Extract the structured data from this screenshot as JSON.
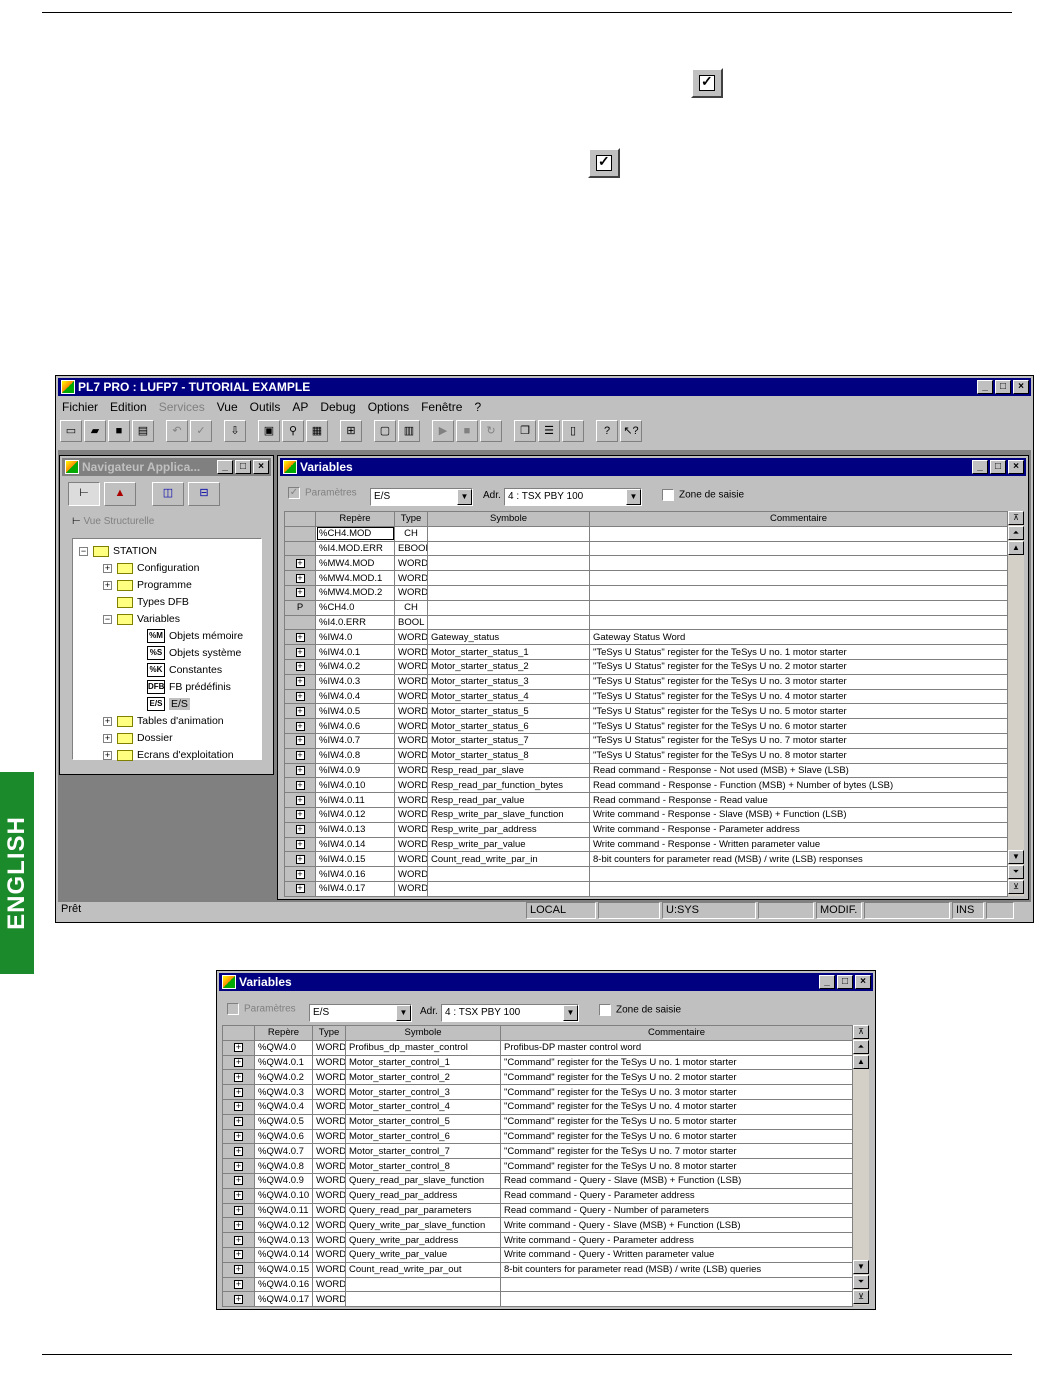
{
  "side_tab": "ENGLISH",
  "main_window": {
    "title": "PL7 PRO : LUFP7 - TUTORIAL EXAMPLE",
    "menu": [
      "Fichier",
      "Edition",
      "Services",
      "Vue",
      "Outils",
      "AP",
      "Debug",
      "Options",
      "Fenêtre",
      "?"
    ],
    "status": {
      "ready": "Prêt",
      "local": "LOCAL",
      "usys": "U:SYS",
      "modif": "MODIF.",
      "ins": "INS"
    },
    "navigator": {
      "title": "Navigateur Applica...",
      "view_label": "Vue Structurelle",
      "items": [
        "STATION",
        "Configuration",
        "Programme",
        "Types DFB",
        "Variables",
        "Objets mémoire",
        "Objets système",
        "Constantes",
        "FB prédéfinis",
        "E/S",
        "Tables d'animation",
        "Dossier",
        "Ecrans d'exploitation"
      ],
      "icons": [
        "%M",
        "%S",
        "%K",
        "DFB",
        "E/S"
      ]
    }
  },
  "var_window_1": {
    "title": "Variables",
    "params_label": "Paramètres",
    "combo_value": "E/S",
    "adr_label": "Adr.",
    "adr_value": "4 : TSX PBY 100",
    "zone_label": "Zone de saisie",
    "headers": [
      "Repère",
      "Type",
      "Symbole",
      "Commentaire"
    ],
    "rows": [
      [
        "",
        "%CH4.MOD",
        "CH",
        "",
        ""
      ],
      [
        "",
        "%I4.MOD.ERR",
        "EBOOL",
        "",
        ""
      ],
      [
        "+",
        "%MW4.MOD",
        "WORD",
        "",
        ""
      ],
      [
        "+",
        "%MW4.MOD.1",
        "WORD",
        "",
        ""
      ],
      [
        "+",
        "%MW4.MOD.2",
        "WORD",
        "",
        ""
      ],
      [
        "P",
        "%CH4.0",
        "CH",
        "",
        ""
      ],
      [
        "",
        "%I4.0.ERR",
        "BOOL",
        "",
        ""
      ],
      [
        "+",
        "%IW4.0",
        "WORD",
        "Gateway_status",
        "Gateway Status Word"
      ],
      [
        "+",
        "%IW4.0.1",
        "WORD",
        "Motor_starter_status_1",
        "\"TeSys U Status\" register for the TeSys U no. 1 motor starter"
      ],
      [
        "+",
        "%IW4.0.2",
        "WORD",
        "Motor_starter_status_2",
        "\"TeSys U Status\" register for the TeSys U no. 2 motor starter"
      ],
      [
        "+",
        "%IW4.0.3",
        "WORD",
        "Motor_starter_status_3",
        "\"TeSys U Status\" register for the TeSys U no. 3 motor starter"
      ],
      [
        "+",
        "%IW4.0.4",
        "WORD",
        "Motor_starter_status_4",
        "\"TeSys U Status\" register for the TeSys U no. 4 motor starter"
      ],
      [
        "+",
        "%IW4.0.5",
        "WORD",
        "Motor_starter_status_5",
        "\"TeSys U Status\" register for the TeSys U no. 5 motor starter"
      ],
      [
        "+",
        "%IW4.0.6",
        "WORD",
        "Motor_starter_status_6",
        "\"TeSys U Status\" register for the TeSys U no. 6 motor starter"
      ],
      [
        "+",
        "%IW4.0.7",
        "WORD",
        "Motor_starter_status_7",
        "\"TeSys U Status\" register for the TeSys U no. 7 motor starter"
      ],
      [
        "+",
        "%IW4.0.8",
        "WORD",
        "Motor_starter_status_8",
        "\"TeSys U Status\" register for the TeSys U no. 8 motor starter"
      ],
      [
        "+",
        "%IW4.0.9",
        "WORD",
        "Resp_read_par_slave",
        "Read command - Response - Not used (MSB) + Slave (LSB)"
      ],
      [
        "+",
        "%IW4.0.10",
        "WORD",
        "Resp_read_par_function_bytes",
        "Read command - Response - Function (MSB) + Number of bytes (LSB)"
      ],
      [
        "+",
        "%IW4.0.11",
        "WORD",
        "Resp_read_par_value",
        "Read command - Response - Read value"
      ],
      [
        "+",
        "%IW4.0.12",
        "WORD",
        "Resp_write_par_slave_function",
        "Write command - Response - Slave (MSB) + Function (LSB)"
      ],
      [
        "+",
        "%IW4.0.13",
        "WORD",
        "Resp_write_par_address",
        "Write command - Response - Parameter address"
      ],
      [
        "+",
        "%IW4.0.14",
        "WORD",
        "Resp_write_par_value",
        "Write command - Response - Written parameter value"
      ],
      [
        "+",
        "%IW4.0.15",
        "WORD",
        "Count_read_write_par_in",
        "8-bit counters for parameter read (MSB) / write (LSB) responses"
      ],
      [
        "+",
        "%IW4.0.16",
        "WORD",
        "",
        ""
      ],
      [
        "+",
        "%IW4.0.17",
        "WORD",
        "",
        ""
      ]
    ]
  },
  "var_window_2": {
    "title": "Variables",
    "params_label": "Paramètres",
    "combo_value": "E/S",
    "adr_label": "Adr.",
    "adr_value": "4 : TSX PBY 100",
    "zone_label": "Zone de saisie",
    "headers": [
      "Repère",
      "Type",
      "Symbole",
      "Commentaire"
    ],
    "rows": [
      [
        "+",
        "%QW4.0",
        "WORD",
        "Profibus_dp_master_control",
        "Profibus-DP master control word"
      ],
      [
        "+",
        "%QW4.0.1",
        "WORD",
        "Motor_starter_control_1",
        "\"Command\" register for the TeSys U no. 1 motor starter"
      ],
      [
        "+",
        "%QW4.0.2",
        "WORD",
        "Motor_starter_control_2",
        "\"Command\" register for the TeSys U no. 2 motor starter"
      ],
      [
        "+",
        "%QW4.0.3",
        "WORD",
        "Motor_starter_control_3",
        "\"Command\" register for the TeSys U no. 3 motor starter"
      ],
      [
        "+",
        "%QW4.0.4",
        "WORD",
        "Motor_starter_control_4",
        "\"Command\" register for the TeSys U no. 4 motor starter"
      ],
      [
        "+",
        "%QW4.0.5",
        "WORD",
        "Motor_starter_control_5",
        "\"Command\" register for the TeSys U no. 5 motor starter"
      ],
      [
        "+",
        "%QW4.0.6",
        "WORD",
        "Motor_starter_control_6",
        "\"Command\" register for the TeSys U no. 6 motor starter"
      ],
      [
        "+",
        "%QW4.0.7",
        "WORD",
        "Motor_starter_control_7",
        "\"Command\" register for the TeSys U no. 7 motor starter"
      ],
      [
        "+",
        "%QW4.0.8",
        "WORD",
        "Motor_starter_control_8",
        "\"Command\" register for the TeSys U no. 8 motor starter"
      ],
      [
        "+",
        "%QW4.0.9",
        "WORD",
        "Query_read_par_slave_function",
        "Read command - Query - Slave (MSB) + Function (LSB)"
      ],
      [
        "+",
        "%QW4.0.10",
        "WORD",
        "Query_read_par_address",
        "Read command - Query - Parameter address"
      ],
      [
        "+",
        "%QW4.0.11",
        "WORD",
        "Query_read_par_parameters",
        "Read command - Query - Number of parameters"
      ],
      [
        "+",
        "%QW4.0.12",
        "WORD",
        "Query_write_par_slave_function",
        "Write command - Query - Slave (MSB) + Function (LSB)"
      ],
      [
        "+",
        "%QW4.0.13",
        "WORD",
        "Query_write_par_address",
        "Write command - Query - Parameter address"
      ],
      [
        "+",
        "%QW4.0.14",
        "WORD",
        "Query_write_par_value",
        "Write command - Query - Written parameter value"
      ],
      [
        "+",
        "%QW4.0.15",
        "WORD",
        "Count_read_write_par_out",
        "8-bit counters for parameter read (MSB) / write (LSB) queries"
      ],
      [
        "+",
        "%QW4.0.16",
        "WORD",
        "",
        ""
      ],
      [
        "+",
        "%QW4.0.17",
        "WORD",
        "",
        ""
      ]
    ]
  }
}
